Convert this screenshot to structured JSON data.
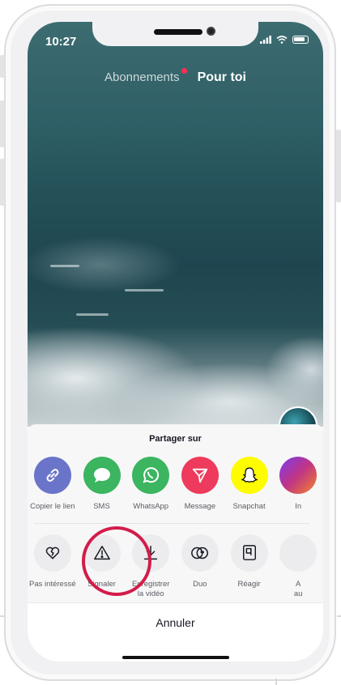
{
  "status_bar": {
    "time": "10:27"
  },
  "top_tabs": [
    {
      "label": "Abonnements",
      "active": false,
      "notification": true
    },
    {
      "label": "Pour toi",
      "active": true
    }
  ],
  "share_sheet": {
    "title": "Partager sur",
    "share_targets": [
      {
        "label": "Copier le lien",
        "icon": "link-icon",
        "color": "#6a74c9"
      },
      {
        "label": "SMS",
        "icon": "chat-bubble-icon",
        "color": "#3bb55f"
      },
      {
        "label": "WhatsApp",
        "icon": "whatsapp-icon",
        "color": "#3bb55f"
      },
      {
        "label": "Message",
        "icon": "send-icon",
        "color": "#ee3a5c"
      },
      {
        "label": "Snapchat",
        "icon": "snapchat-ghost-icon",
        "color": "#fffc00"
      },
      {
        "label": "In",
        "icon": "instagram-icon",
        "color": "#c13584"
      }
    ],
    "actions": [
      {
        "label": "Pas intéressé",
        "icon": "broken-heart-icon"
      },
      {
        "label": "Signaler",
        "icon": "warning-icon",
        "highlighted": true
      },
      {
        "label": "Enregistrer\nla vidéo",
        "icon": "download-icon"
      },
      {
        "label": "Duo",
        "icon": "duet-icon"
      },
      {
        "label": "Réagir",
        "icon": "react-icon"
      },
      {
        "label": "A\nau",
        "icon": "more-icon"
      }
    ],
    "cancel_label": "Annuler"
  },
  "colors": {
    "accent": "#fe2c55",
    "highlight_ring": "#d31c4a"
  }
}
